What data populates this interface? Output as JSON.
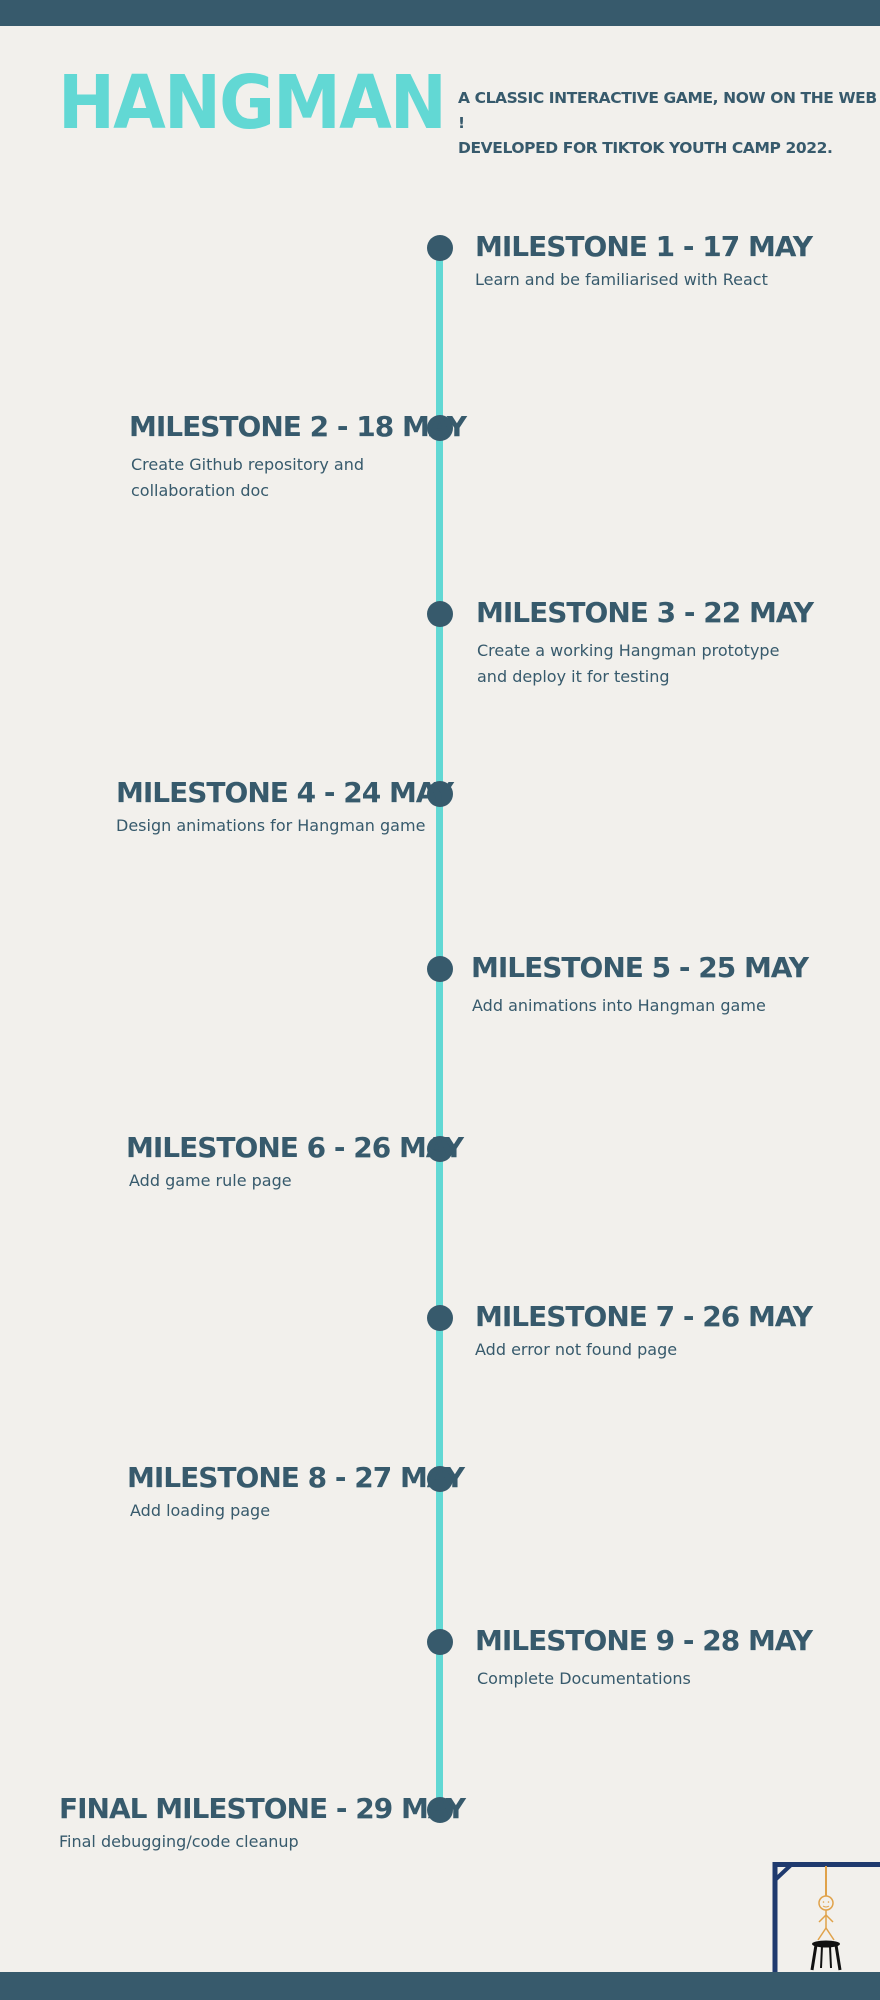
{
  "header": {
    "title": "HANGMAN",
    "tagline_line1": "A CLASSIC INTERACTIVE GAME,  NOW ON THE WEB !",
    "tagline_line2": "DEVELOPED FOR TIKTOK YOUTH CAMP 2022."
  },
  "milestones": [
    {
      "title": "MILESTONE 1 - 17 MAY",
      "desc": [
        "Learn and be familiarised with React"
      ]
    },
    {
      "title": "MILESTONE 2 - 18 MAY",
      "desc": [
        "Create Github repository and",
        "collaboration doc"
      ]
    },
    {
      "title": "MILESTONE 3 -  22 MAY",
      "desc": [
        "Create a working Hangman prototype",
        "and deploy it for testing"
      ]
    },
    {
      "title": "MILESTONE 4 -  24 MAY",
      "desc": [
        "Design animations for Hangman game"
      ]
    },
    {
      "title": "MILESTONE 5 - 25 MAY",
      "desc": [
        "Add animations into Hangman game"
      ]
    },
    {
      "title": "MILESTONE 6 - 26 MAY",
      "desc": [
        "Add game rule page"
      ]
    },
    {
      "title": "MILESTONE 7 - 26 MAY",
      "desc": [
        "Add error not found page"
      ]
    },
    {
      "title": "MILESTONE 8 - 27 MAY",
      "desc": [
        "Add loading page"
      ]
    },
    {
      "title": "MILESTONE 9 - 28 MAY",
      "desc": [
        "Complete Documentations"
      ]
    },
    {
      "title": "FINAL MILESTONE -  29 MAY",
      "desc": [
        "Final debugging/code cleanup"
      ]
    }
  ],
  "colors": {
    "accent": "#62d8d4",
    "primary": "#375a6c",
    "background": "#f2f0ec",
    "figure": "#e0a24a"
  },
  "icons": {
    "corner_illustration": "hangman-gallows-icon"
  }
}
